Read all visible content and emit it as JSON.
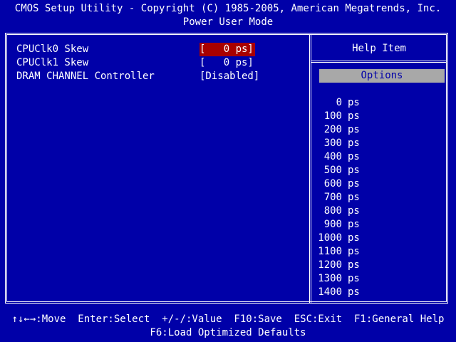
{
  "header": {
    "title": "CMOS Setup Utility - Copyright (C) 1985-2005, American Megatrends, Inc.",
    "subtitle": "Power User Mode"
  },
  "settings": [
    {
      "name": "CPUClk0 Skew",
      "value": "[   0 ps]",
      "selected": true
    },
    {
      "name": "CPUClk1 Skew",
      "value": "[   0 ps]",
      "selected": false
    },
    {
      "name": "DRAM CHANNEL Controller",
      "value": "[Disabled]",
      "selected": false
    }
  ],
  "help": {
    "title": "Help Item",
    "options_label": "Options",
    "unit": "ps",
    "options": [
      "0",
      "100",
      "200",
      "300",
      "400",
      "500",
      "600",
      "700",
      "800",
      "900",
      "1000",
      "1100",
      "1200",
      "1300",
      "1400"
    ]
  },
  "footer": {
    "line1": "↑↓←→:Move  Enter:Select  +/-/:Value  F10:Save  ESC:Exit  F1:General Help",
    "line2": "F6:Load Optimized Defaults"
  },
  "colors": {
    "background": "#0000a8",
    "text": "#ffffff",
    "selection": "#a80000",
    "options_bar": "#a8a8a8"
  }
}
